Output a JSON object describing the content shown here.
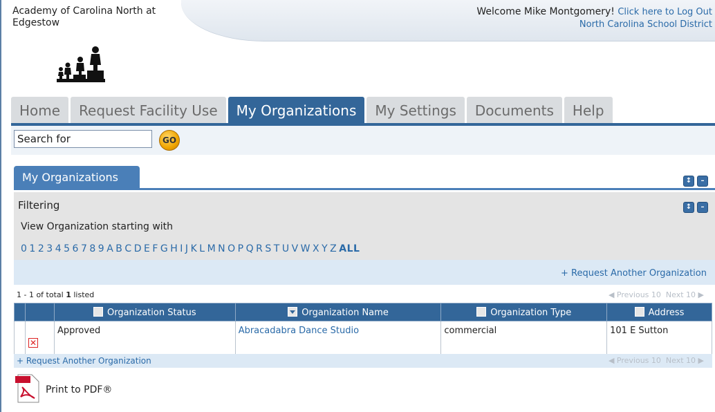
{
  "header": {
    "school_name": "Academy of Carolina North at Edgestow",
    "welcome": "Welcome Mike Montgomery!",
    "logout": "Click here to Log Out",
    "district": "North Carolina School District"
  },
  "nav": {
    "tabs": [
      {
        "label": "Home"
      },
      {
        "label": "Request Facility Use"
      },
      {
        "label": "My Organizations",
        "active": true
      },
      {
        "label": "My Settings"
      },
      {
        "label": "Documents"
      },
      {
        "label": "Help"
      }
    ]
  },
  "search": {
    "value": "Search for",
    "go_label": "GO"
  },
  "panel": {
    "title": "My Organizations",
    "filter_title": "Filtering",
    "filter_sub": "View Organization starting with",
    "letters": [
      "0",
      "1",
      "2",
      "3",
      "4",
      "5",
      "6",
      "7",
      "8",
      "9",
      "A",
      "B",
      "C",
      "D",
      "E",
      "F",
      "G",
      "H",
      "I",
      "J",
      "K",
      "L",
      "M",
      "N",
      "O",
      "P",
      "Q",
      "R",
      "S",
      "T",
      "U",
      "V",
      "W",
      "X",
      "Y",
      "Z"
    ],
    "all_label": "ALL",
    "request_link": "+ Request Another Organization"
  },
  "listing": {
    "prefix": "1 - 1 of total",
    "total": "1",
    "suffix": "listed",
    "prev": "Previous 10",
    "next": "Next 10"
  },
  "table": {
    "columns": [
      "Organization Status",
      "Organization Name",
      "Organization Type",
      "Address"
    ],
    "rows": [
      {
        "status": "Approved",
        "name": "Abracadabra Dance Studio",
        "type": "commercial",
        "address": "101 E Sutton"
      }
    ]
  },
  "footer": {
    "request_link": "+ Request Another Organization",
    "print_label": "Print to PDF®"
  },
  "colors": {
    "brand": "#336699",
    "link": "#2a6aa8"
  }
}
